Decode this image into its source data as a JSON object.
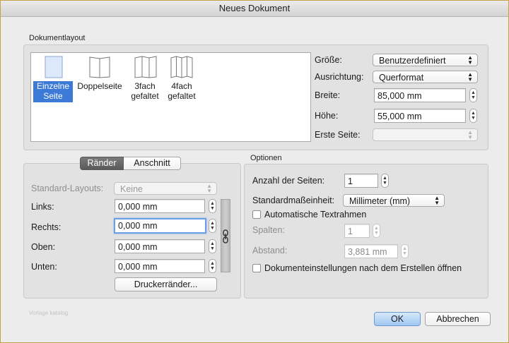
{
  "window": {
    "title": "Neues Dokument"
  },
  "document_layout": {
    "group_label": "Dokumentlayout",
    "items": [
      {
        "label_line1": "Einzelne",
        "label_line2": "Seite",
        "icon": "single-page-icon",
        "selected": true
      },
      {
        "label_line1": "Doppelseite",
        "label_line2": "",
        "icon": "double-page-icon",
        "selected": false
      },
      {
        "label_line1": "3fach",
        "label_line2": "gefaltet",
        "icon": "trifold-icon",
        "selected": false
      },
      {
        "label_line1": "4fach",
        "label_line2": "gefaltet",
        "icon": "fourfold-icon",
        "selected": false
      }
    ],
    "size_label": "Größe:",
    "size_value": "Benutzerdefiniert",
    "orientation_label": "Ausrichtung:",
    "orientation_value": "Querformat",
    "width_label": "Breite:",
    "width_value": "85,000 mm",
    "height_label": "Höhe:",
    "height_value": "55,000 mm",
    "first_page_label": "Erste Seite:",
    "first_page_value": ""
  },
  "margins": {
    "tab_margins": "Ränder",
    "tab_bleed": "Anschnitt",
    "standard_layouts_label": "Standard-Layouts:",
    "standard_layouts_value": "Keine",
    "left_label": "Links:",
    "left_value": "0,000 mm",
    "right_label": "Rechts:",
    "right_value": "0,000 mm",
    "top_label": "Oben:",
    "top_value": "0,000 mm",
    "bottom_label": "Unten:",
    "bottom_value": "0,000 mm",
    "printer_margins_button": "Druckerränder..."
  },
  "options": {
    "group_label": "Optionen",
    "page_count_label": "Anzahl der Seiten:",
    "page_count_value": "1",
    "unit_label": "Standardmaßeinheit:",
    "unit_value": "Millimeter (mm)",
    "auto_text_frames_label": "Automatische Textrahmen",
    "columns_label": "Spalten:",
    "columns_value": "1",
    "spacing_label": "Abstand:",
    "spacing_value": "3,881 mm",
    "open_settings_label": "Dokumenteinstellungen nach dem Erstellen öffnen"
  },
  "footer": {
    "watermark": "Vorlage katalog",
    "ok_button": "OK",
    "cancel_button": "Abbrechen"
  },
  "colors": {
    "accent": "#3b7ad7",
    "default_button": "#9fc8f2",
    "frame_border": "#c2a24a"
  }
}
